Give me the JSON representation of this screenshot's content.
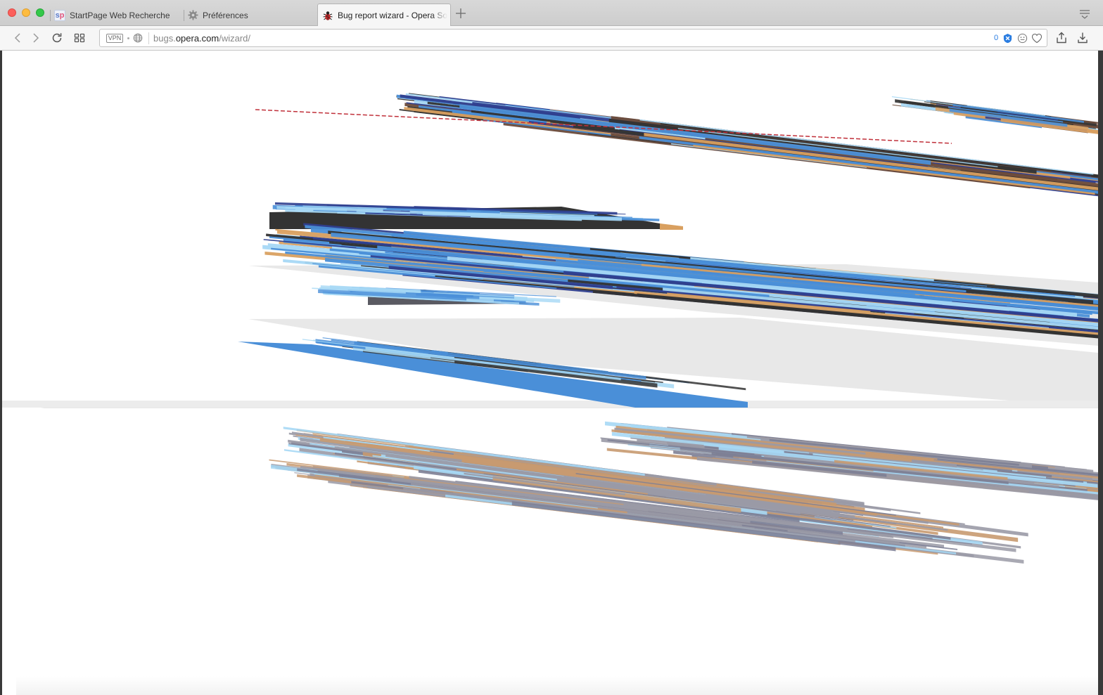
{
  "window": {
    "controls": [
      "close",
      "minimize",
      "zoom"
    ]
  },
  "tabs": [
    {
      "label": "StartPage Web Recherche",
      "favicon": "startpage-icon",
      "active": false
    },
    {
      "label": "Préférences",
      "favicon": "gear-icon",
      "active": false
    },
    {
      "label": "Bug report wizard - Opera So",
      "favicon": "bug-icon",
      "active": true
    }
  ],
  "toolbar": {
    "vpn_label": "VPN",
    "url": {
      "prefix": "bugs.",
      "host": "opera.com",
      "path": "/wizard/"
    },
    "ad_block_count": "0",
    "icons": [
      "back-icon",
      "forward-icon",
      "reload-icon",
      "speed-dial-icon",
      "globe-icon",
      "ad-block-icon",
      "emoji-icon",
      "heart-icon",
      "share-icon",
      "download-icon"
    ]
  },
  "page": {
    "state": "corrupted render",
    "colors": {
      "dark": "#333333",
      "blue": "#4a8fd8",
      "light_blue": "#a6d8f5",
      "navy": "#2f3f8f",
      "orange": "#d9a060",
      "gray_band": "#e8e8e8",
      "faded": "#9a9aa6"
    }
  }
}
